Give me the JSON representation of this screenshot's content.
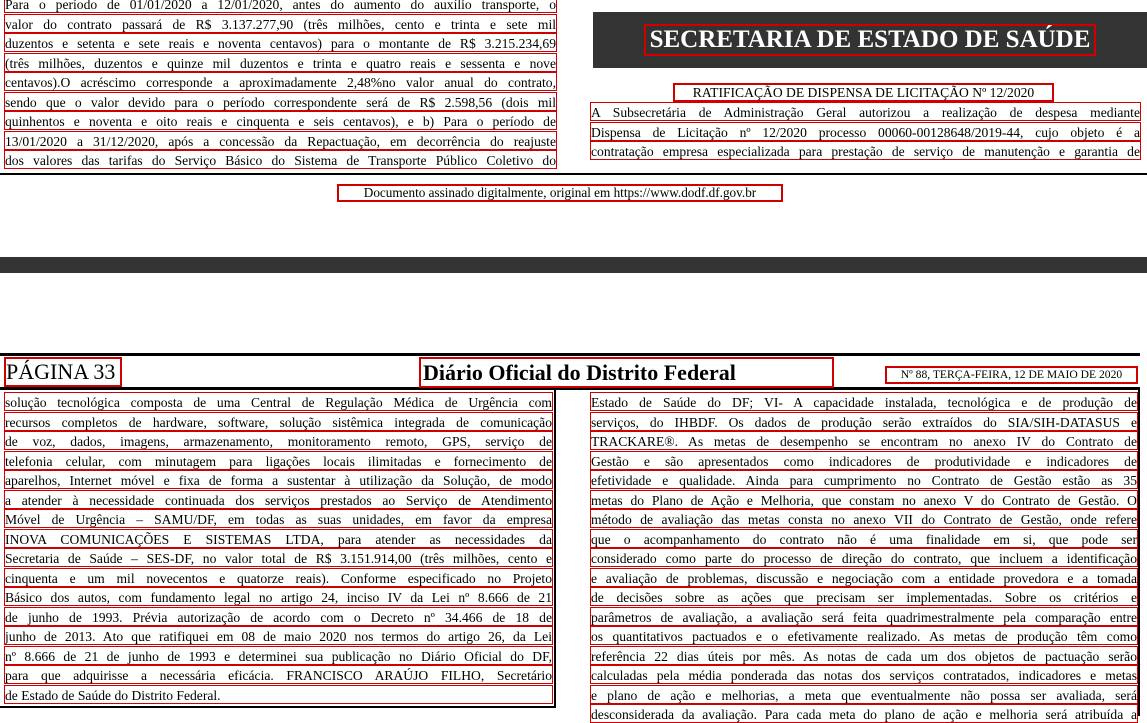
{
  "top": {
    "left_lines": [
      "Para o período de 01/01/2020 a 12/01/2020, antes do aumento do auxílio transporte, o",
      "valor do contrato passará de R$ 3.137.277,90 (três milhões, cento e trinta e sete mil",
      "duzentos e setenta e sete reais e noventa centavos) para o montante de R$ 3.215.234,69",
      "(três milhões, duzentos e quinze mil duzentos e trinta e quatro reais e sessenta e nove",
      "centavos).O acréscimo corresponde a aproximadamente 2,48%no valor anual do contrato,",
      "sendo que o valor devido para o período correspondente será de R$ 2.598,56 (dois mil",
      "quinhentos e noventa e oito reais e cinquenta e seis centavos), e b) Para o período de",
      "13/01/2020 a 31/12/2020, após a concessão da Repactuação, em decorrência do reajuste",
      "dos valores das tarifas do Serviço Básico do Sistema de Transporte Público Coletivo do"
    ],
    "secretaria_title": "SECRETARIA DE ESTADO DE SAÚDE",
    "ratificacao_title": "RATIFICAÇÃO DE DISPENSA DE LICITAÇÃO Nº 12/2020",
    "right_lines": [
      "A Subsecretária de Administração Geral autorizou a realização de despesa mediante",
      "Dispensa de Licitação nº 12/2020 processo 00060-00128648/2019-44, cujo objeto é a",
      "contratação empresa especializada para prestação de serviço de manutenção e garantia de"
    ],
    "signature_note": "Documento assinado digitalmente, original em https://www.dodf.df.gov.br"
  },
  "header": {
    "page_label": "PÁGINA 33",
    "newspaper_title": "Diário Oficial do Distrito Federal",
    "issue_info": "Nº 88, TERÇA-FEIRA, 12 DE MAIO DE 2020"
  },
  "bottom": {
    "left_lines": [
      "solução tecnológica composta de uma Central de Regulação Médica de Urgência com",
      "recursos completos de hardware, software, solução sistêmica integrada de comunicação",
      "de voz, dados, imagens, armazenamento, monitoramento remoto, GPS, serviço de",
      "telefonia celular, com minutagem para ligações locais ilimitadas e fornecimento de",
      "aparelhos, Internet móvel e fixa de forma a sustentar à utilização da Solução, de modo",
      "a atender à necessidade continuada dos serviços prestados ao Serviço de Atendimento",
      "Móvel de Urgência – SAMU/DF, em todas as suas unidades, em favor da empresa",
      "INOVA COMUNICAÇÕES E SISTEMAS LTDA, para atender as necessidades da",
      "Secretaria de Saúde – SES-DF, no valor total de R$ 3.151.914,00 (três milhões, cento e",
      "cinquenta e um mil novecentos e quatorze reais). Conforme especificado no Projeto",
      "Básico dos autos, com fundamento legal no artigo 24, inciso IV da Lei nº 8.666 de 21",
      "de junho de 1993. Prévia autorização de acordo com o Decreto nº 34.466 de 18 de",
      "junho de 2013. Ato que ratifiquei em 08 de maio 2020 nos termos do artigo 26, da Lei",
      "nº 8.666 de 21 de junho de 1993 e determinei sua publicação no Diário Oficial do DF,",
      "para que adquirisse a necessária eficácia. FRANCISCO ARAÚJO FILHO, Secretário",
      "de Estado de Saúde do Distrito Federal."
    ],
    "right_lines": [
      "Estado de Saúde do DF; VI- A capacidade instalada, tecnológica e de produção de",
      "serviços, do IHBDF. Os dados de produção serão extraídos do SIA/SIH-DATASUS e",
      "TRACKARE®. As metas de desempenho se encontram no anexo IV do Contrato de",
      "Gestão e são apresentados como indicadores de produtividade e indicadores de",
      "efetividade e qualidade. Ainda para cumprimento no Contrato de Gestão estão as 35",
      "metas do Plano de Ação e Melhoria, que constam no anexo V do Contrato de Gestão. O",
      "método de avaliação das metas consta no anexo VII do Contrato de Gestão, onde refere",
      "que o acompanhamento do contrato não é uma finalidade em si, que pode ser",
      "considerado como parte do processo de direção do contrato, que incluem a identificação",
      "e avaliação de problemas, discussão e negociação com a entidade provedora e a tomada",
      "de decisões sobre as ações que precisam ser implementadas. Sobre os critérios e",
      "parâmetros de avaliação, a avaliação será feita quadrimestralmente pela comparação entre",
      "os quantitativos pactuados e o efetivamente realizado. As metas de produção têm como",
      "referência 22 dias úteis por mês. As notas de cada um dos objetos de pactuação serão",
      "calculadas pela média ponderada das notas dos serviços contratados, indicadores e metas",
      "e plano de ação e melhorias, a meta que eventualmente não possa ser avaliada, será",
      "desconsiderada da avaliação. Para cada meta do plano de ação e melhoria será atribuída a"
    ]
  }
}
